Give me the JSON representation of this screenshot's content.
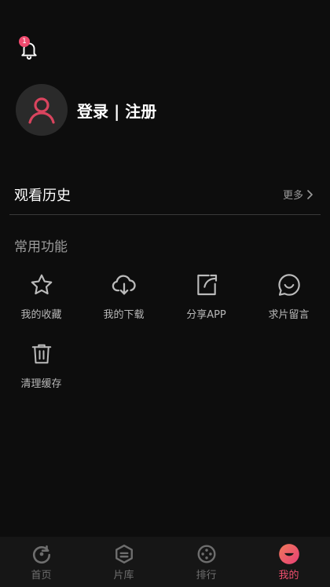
{
  "header": {
    "notification_count": "1"
  },
  "profile": {
    "login_label": "登录 | 注册"
  },
  "history": {
    "title": "观看历史",
    "more_label": "更多"
  },
  "functions": {
    "title": "常用功能",
    "items": [
      {
        "label": "我的收藏",
        "icon": "star-icon"
      },
      {
        "label": "我的下载",
        "icon": "cloud-download-icon"
      },
      {
        "label": "分享APP",
        "icon": "share-icon"
      },
      {
        "label": "求片留言",
        "icon": "message-icon"
      },
      {
        "label": "清理缓存",
        "icon": "trash-icon"
      }
    ]
  },
  "tabbar": {
    "items": [
      {
        "label": "首页",
        "icon": "home-icon",
        "active": false
      },
      {
        "label": "片库",
        "icon": "library-icon",
        "active": false
      },
      {
        "label": "排行",
        "icon": "ranking-icon",
        "active": false
      },
      {
        "label": "我的",
        "icon": "profile-icon",
        "active": true
      }
    ]
  },
  "colors": {
    "accent": "#f0506e",
    "background": "#0d0d0d",
    "tabbar": "#161616"
  }
}
